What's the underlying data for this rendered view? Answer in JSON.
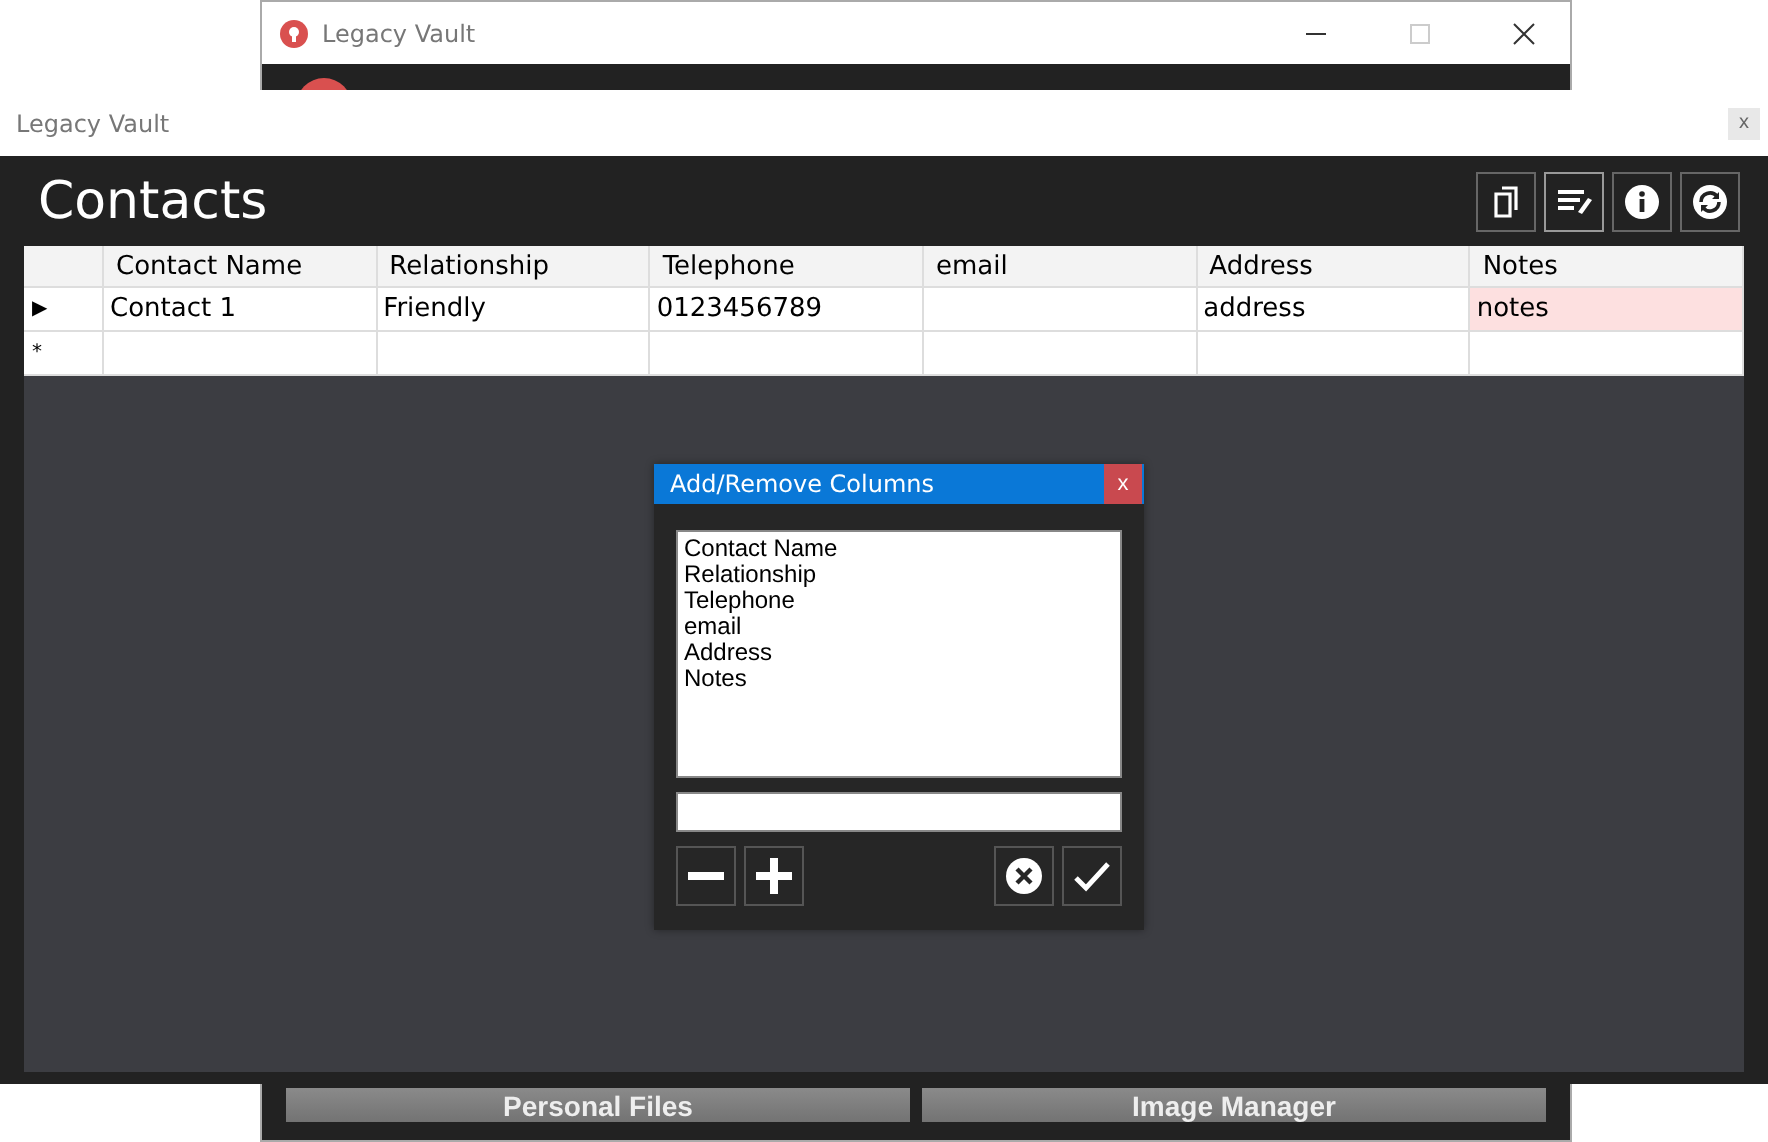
{
  "back_window": {
    "title": "Legacy Vault",
    "buttons": [
      "Personal Files",
      "Image Manager"
    ]
  },
  "window": {
    "title": "Legacy Vault",
    "close": "x",
    "heading": "Contacts"
  },
  "table": {
    "columns": [
      "Contact Name",
      "Relationship",
      "Telephone",
      "email",
      "Address",
      "Notes"
    ],
    "rows": [
      {
        "marker": "▶",
        "cells": [
          {
            "text": "Contact 1",
            "selected": false
          },
          {
            "text": "Friendly",
            "selected": false
          },
          {
            "text": "0123456789",
            "selected": false
          },
          {
            "selected": false
          },
          {
            "text": "address",
            "selected": false
          },
          {
            "text": "notes",
            "selected": true
          }
        ]
      },
      {
        "marker": "*",
        "cells": [
          {
            "selected": false
          },
          {
            "selected": false
          },
          {
            "selected": false
          },
          {
            "selected": false
          },
          {
            "selected": false
          },
          {
            "selected": false
          }
        ]
      }
    ]
  },
  "dialog": {
    "title": "Add/Remove Columns",
    "close": "x",
    "items": [
      "Contact Name",
      "Relationship",
      "Telephone",
      "email",
      "Address",
      "Notes"
    ]
  }
}
